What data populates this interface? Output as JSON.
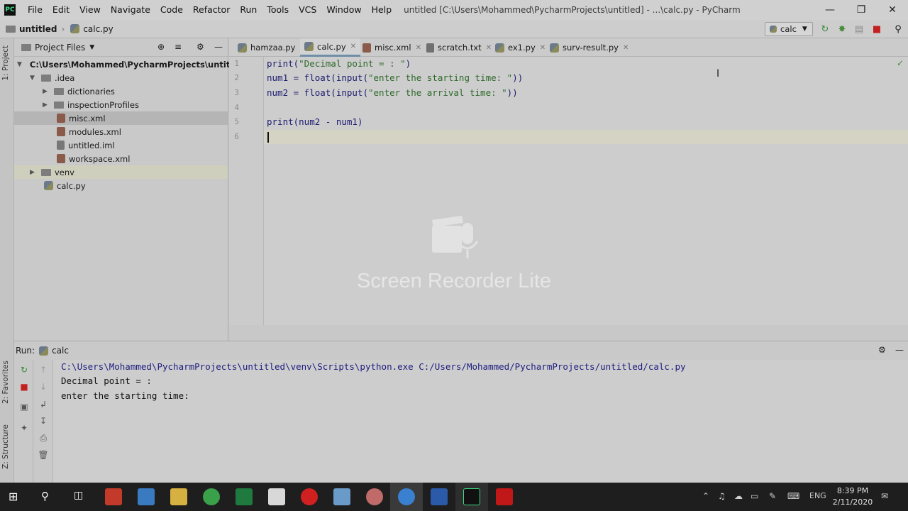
{
  "window": {
    "title": "untitled [C:\\Users\\Mohammed\\PycharmProjects\\untitled] - ...\\calc.py - PyCharm",
    "menu": [
      "File",
      "Edit",
      "View",
      "Navigate",
      "Code",
      "Refactor",
      "Run",
      "Tools",
      "VCS",
      "Window",
      "Help"
    ]
  },
  "navbar": {
    "project": "untitled",
    "file": "calc.py",
    "run_config": "calc"
  },
  "tool_stripe": {
    "project": "1: Project",
    "favorites": "2: Favorites",
    "structure": "Z: Structure"
  },
  "project_panel": {
    "title": "Project Files",
    "tree": [
      {
        "label": "C:\\Users\\Mohammed\\PycharmProjects\\untitled",
        "kind": "folder"
      },
      {
        "label": ".idea",
        "kind": "folder"
      },
      {
        "label": "dictionaries",
        "kind": "folder"
      },
      {
        "label": "inspectionProfiles",
        "kind": "folder"
      },
      {
        "label": "misc.xml",
        "kind": "xml"
      },
      {
        "label": "modules.xml",
        "kind": "xml"
      },
      {
        "label": "untitled.iml",
        "kind": "iml"
      },
      {
        "label": "workspace.xml",
        "kind": "xml"
      },
      {
        "label": "venv",
        "kind": "folder"
      },
      {
        "label": "calc.py",
        "kind": "py"
      }
    ]
  },
  "tabs": [
    {
      "label": "hamzaa.py"
    },
    {
      "label": "calc.py"
    },
    {
      "label": "misc.xml"
    },
    {
      "label": "scratch.txt"
    },
    {
      "label": "ex1.py"
    },
    {
      "label": "surv-result.py"
    }
  ],
  "editor": {
    "line_numbers": [
      "1",
      "2",
      "3",
      "4",
      "5",
      "6"
    ],
    "lines": [
      {
        "fn": "print(",
        "str": "\"Decimal point = : \"",
        "rest": ")"
      },
      {
        "fn": "num1 = float(input(",
        "str": "\"enter the starting time: \"",
        "rest": "))"
      },
      {
        "fn": "num2 = float(input(",
        "str": "\"enter the arrival time: \"",
        "rest": "))"
      },
      {
        "fn": "",
        "str": "",
        "rest": ""
      },
      {
        "fn": "print(num2 - num1)",
        "str": "",
        "rest": ""
      },
      {
        "fn": "",
        "str": "",
        "rest": ""
      }
    ]
  },
  "watermark": "Screen Recorder Lite",
  "run_panel": {
    "label": "Run:",
    "config": "calc",
    "output": [
      "C:\\Users\\Mohammed\\PycharmProjects\\untitled\\venv\\Scripts\\python.exe C:/Users/Mohammed/PycharmProjects/untitled/calc.py",
      "Decimal point = :",
      "enter the starting time:"
    ]
  },
  "taskbar": {
    "time": "8:39 PM",
    "date": "2/11/2020",
    "lang": "ENG"
  }
}
